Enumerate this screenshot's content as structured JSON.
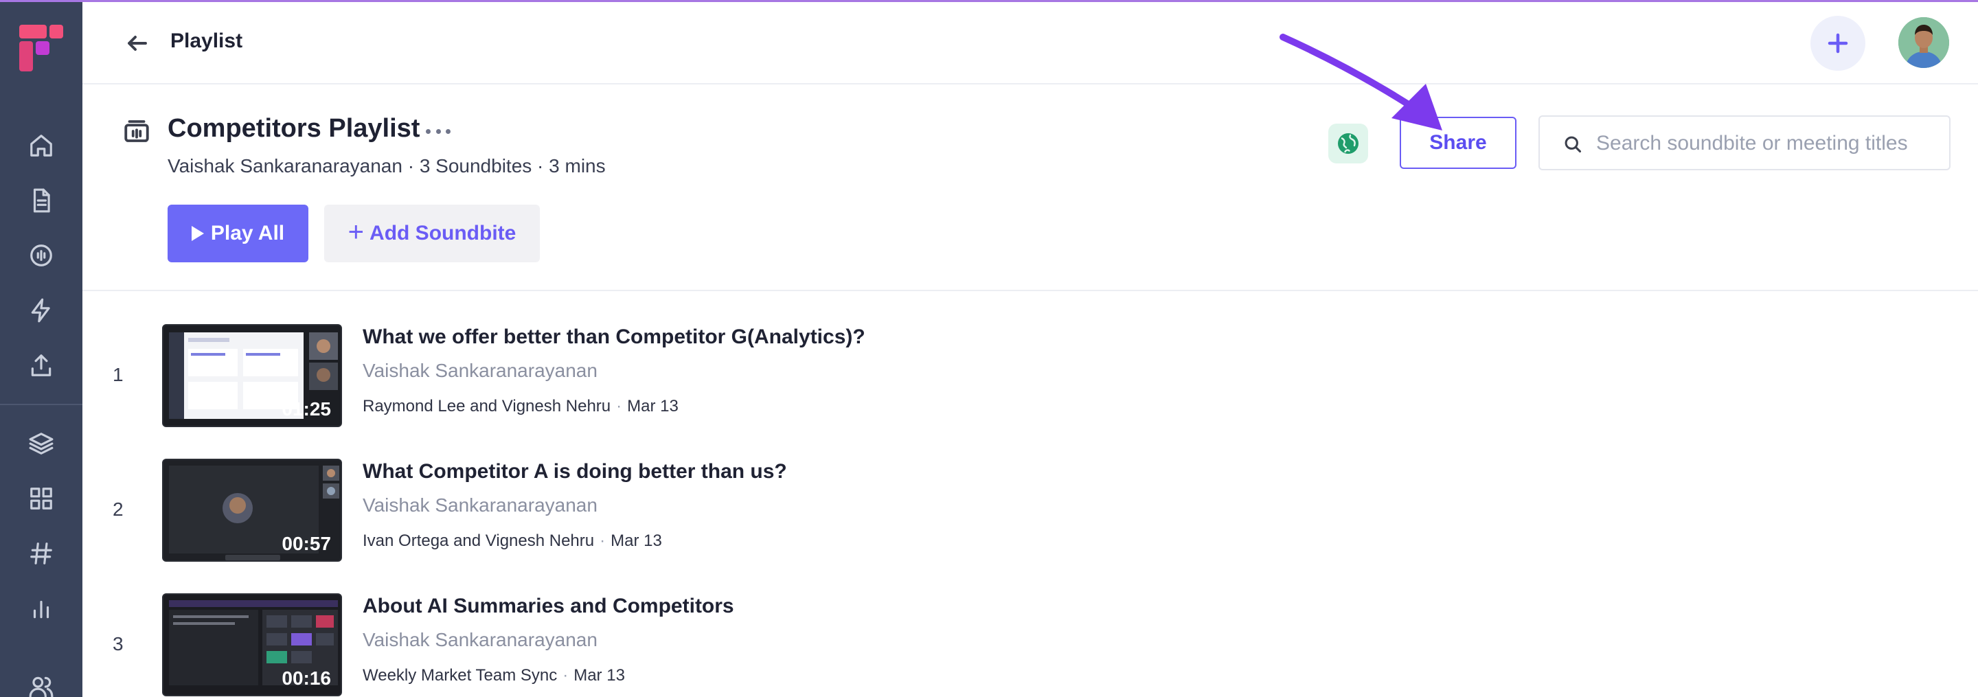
{
  "header": {
    "title": "Playlist"
  },
  "playlist": {
    "title": "Competitors Playlist",
    "meta": "Vaishak Sankaranarayanan · 3 Soundbites · 3 mins",
    "share_label": "Share",
    "search_placeholder": "Search soundbite or meeting titles",
    "play_all_label": "Play All",
    "add_soundbite_label": "Add Soundbite"
  },
  "items": [
    {
      "index": "1",
      "title": "What we offer better than Competitor G(Analytics)?",
      "owner": "Vaishak Sankaranarayanan",
      "meeting": "Raymond Lee and Vignesh Nehru",
      "date": "Mar 13",
      "duration": "01:25"
    },
    {
      "index": "2",
      "title": "What Competitor A is doing better than us?",
      "owner": "Vaishak Sankaranarayanan",
      "meeting": "Ivan Ortega and Vignesh Nehru",
      "date": "Mar 13",
      "duration": "00:57"
    },
    {
      "index": "3",
      "title": "About AI Summaries and Competitors",
      "owner": "Vaishak Sankaranarayanan",
      "meeting": "Weekly Market Team Sync",
      "date": "Mar 13",
      "duration": "00:16"
    }
  ],
  "colors": {
    "sidebar": "#39435b",
    "accent": "#6c69f7",
    "annotation_arrow": "#7c3aed"
  },
  "icons": {
    "sidebar": [
      "home-icon",
      "document-icon",
      "audio-icon",
      "lightning-icon",
      "upload-icon",
      "layers-icon",
      "grid-icon",
      "hashtag-icon",
      "bar-chart-icon",
      "users-icon"
    ],
    "header": [
      "back-arrow-icon",
      "plus-icon",
      "avatar"
    ],
    "playlist": [
      "playlist-icon",
      "more-icon",
      "globe-icon",
      "search-icon",
      "play-icon"
    ]
  }
}
